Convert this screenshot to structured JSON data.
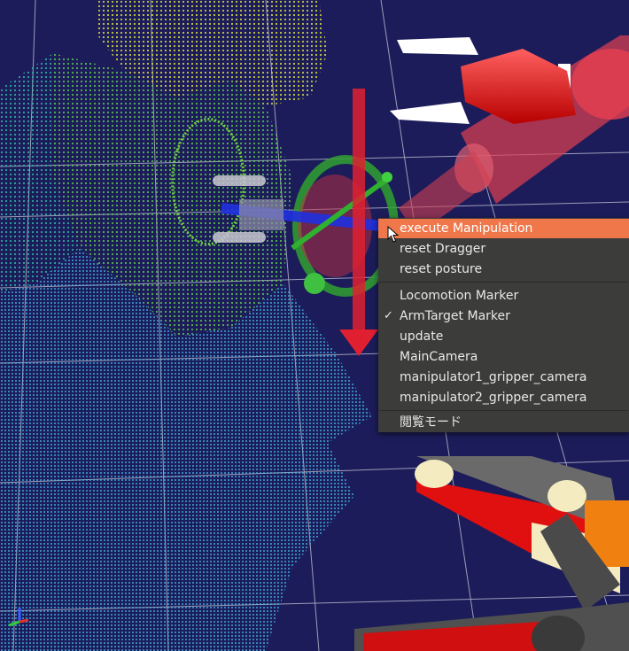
{
  "context_menu": {
    "items": [
      {
        "label": "execute Manipulation",
        "highlighted": true,
        "checked": false
      },
      {
        "label": "reset Dragger",
        "highlighted": false,
        "checked": false
      },
      {
        "label": "reset posture",
        "highlighted": false,
        "checked": false
      },
      {
        "label": "Locomotion Marker",
        "highlighted": false,
        "checked": false
      },
      {
        "label": "ArmTarget Marker",
        "highlighted": false,
        "checked": true
      },
      {
        "label": "update",
        "highlighted": false,
        "checked": false
      },
      {
        "label": "MainCamera",
        "highlighted": false,
        "checked": false
      },
      {
        "label": "manipulator1_gripper_camera",
        "highlighted": false,
        "checked": false
      },
      {
        "label": "manipulator2_gripper_camera",
        "highlighted": false,
        "checked": false
      },
      {
        "label": "閲覧モード",
        "highlighted": false,
        "checked": false
      }
    ],
    "check_glyph": "✓",
    "highlight_color": "#f0774a"
  },
  "scene": {
    "background_color": "#1c1c5a",
    "icons": [
      "mouse-cursor-icon",
      "axis-indicator-icon"
    ]
  }
}
